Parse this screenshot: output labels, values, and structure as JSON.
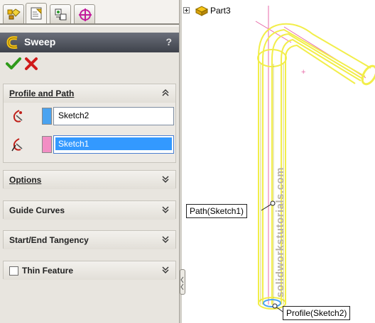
{
  "feature_manager": {
    "tabs": [
      {
        "name": "featuremanager-tree",
        "icon": "featuremanager-tree-icon"
      },
      {
        "name": "propertymanager",
        "icon": "propertymanager-icon"
      },
      {
        "name": "configurationmanager",
        "icon": "configurationmanager-icon"
      },
      {
        "name": "dimxpertmanager",
        "icon": "dimxpertmanager-icon"
      }
    ],
    "title": "Sweep",
    "help": "?",
    "ok_icon": "green-checkmark-icon",
    "cancel_icon": "red-x-icon"
  },
  "profile_path": {
    "label": "Profile and Path",
    "profile": {
      "value": "Sketch2",
      "color": "#4aa3f0"
    },
    "path": {
      "value": "Sketch1",
      "color": "#f28ec4"
    }
  },
  "options": {
    "label": "Options"
  },
  "guide_curves": {
    "label": "Guide Curves"
  },
  "tangency": {
    "label": "Start/End Tangency"
  },
  "thin_feature": {
    "label": "Thin Feature",
    "checked": false
  },
  "graphics": {
    "tree_item": "Part3",
    "path_callout": "Path(Sketch1)",
    "profile_callout": "Profile(Sketch2)",
    "watermark": "solidworkstutorials.com",
    "highlight_color": "#f2ee4a",
    "sketch_color": "#e86aa8"
  }
}
